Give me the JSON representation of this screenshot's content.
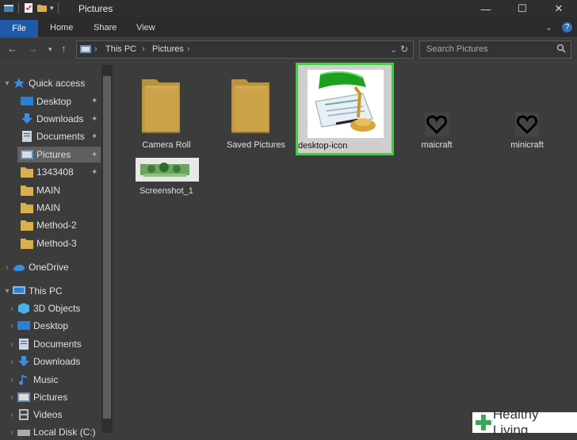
{
  "window": {
    "title": "Pictures",
    "minimize": "—",
    "maximize": "☐",
    "close": "✕"
  },
  "ribbon": {
    "file": "File",
    "tabs": [
      "Home",
      "Share",
      "View"
    ],
    "expand": "⌄",
    "help": "?"
  },
  "address": {
    "crumbs": [
      "This PC",
      "Pictures"
    ],
    "search_placeholder": "Search Pictures"
  },
  "sidebar": {
    "quick_access": "Quick access",
    "quick_items": [
      "Desktop",
      "Downloads",
      "Documents",
      "Pictures",
      "1343408",
      "MAIN",
      "MAIN",
      "Method-2",
      "Method-3"
    ],
    "onedrive": "OneDrive",
    "this_pc": "This PC",
    "pc_items": [
      "3D Objects",
      "Desktop",
      "Documents",
      "Downloads",
      "Music",
      "Pictures",
      "Videos",
      "Local Disk (C:)"
    ]
  },
  "files": [
    {
      "name": "Camera Roll",
      "type": "folder"
    },
    {
      "name": "Saved Pictures",
      "type": "folder"
    },
    {
      "name": "desktop-icon",
      "type": "image-selected"
    },
    {
      "name": "maicraft",
      "type": "image"
    },
    {
      "name": "minicraft",
      "type": "image"
    },
    {
      "name": "Screenshot_1",
      "type": "image"
    }
  ],
  "watermark": {
    "text": "Healthy Living"
  },
  "colors": {
    "accent": "#1e5aa8",
    "highlight": "#3ed13e",
    "background": "#3c3c3c"
  }
}
